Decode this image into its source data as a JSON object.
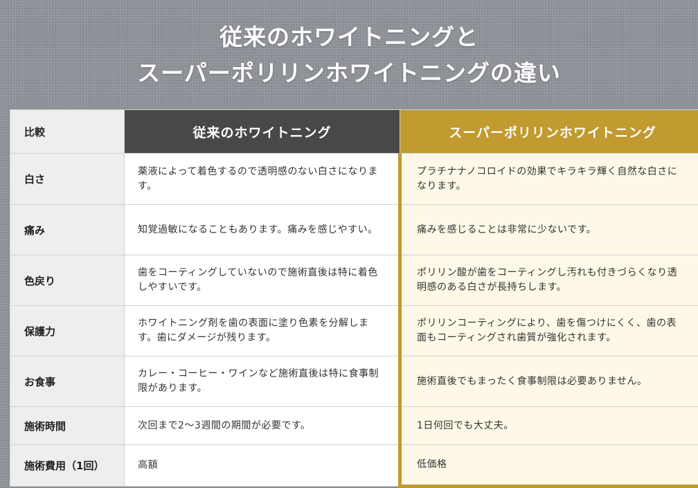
{
  "title": {
    "line1": "従来のホワイトニングと",
    "line2": "スーパーポリリンホワイトニングの違い"
  },
  "colors": {
    "background": "#8d9096",
    "dark_header": "#484848",
    "gold_accent": "#c19a30",
    "gold_cell_bg": "#fdf8e7",
    "label_bg": "#eeeeee"
  },
  "table": {
    "headers": {
      "label": "比較",
      "old": "従来のホワイトニング",
      "new": "スーパーポリリンホワイトニング"
    },
    "rows": [
      {
        "label": "白さ",
        "old": "薬液によって着色するので透明感のない白さになります。",
        "new": "プラチナナノコロイドの効果でキラキラ輝く自然な白さになります。"
      },
      {
        "label": "痛み",
        "old": "知覚過敏になることもあります。痛みを感じやすい。",
        "new": "痛みを感じることは非常に少ないです。"
      },
      {
        "label": "色戻り",
        "old": "歯をコーティングしていないので施術直後は特に着色しやすいです。",
        "new": "ポリリン酸が歯をコーティングし汚れも付きづらくなり透明感のある白さが長持ちします。"
      },
      {
        "label": "保護力",
        "old": "ホワイトニング剤を歯の表面に塗り色素を分解します。歯にダメージが残ります。",
        "new": "ポリリンコーティングにより、歯を傷つけにくく、歯の表面もコーティングされ歯質が強化されます。"
      },
      {
        "label": "お食事",
        "old": "カレー・コーヒー・ワインなど施術直後は特に食事制限があります。",
        "new": "施術直後でもまったく食事制限は必要ありません。"
      },
      {
        "label": "施術時間",
        "old": "次回まで2〜3週間の期間が必要です。",
        "new": "1日何回でも大丈夫。"
      },
      {
        "label": "施術費用（1回）",
        "old": "高額",
        "new": "低価格"
      }
    ]
  }
}
